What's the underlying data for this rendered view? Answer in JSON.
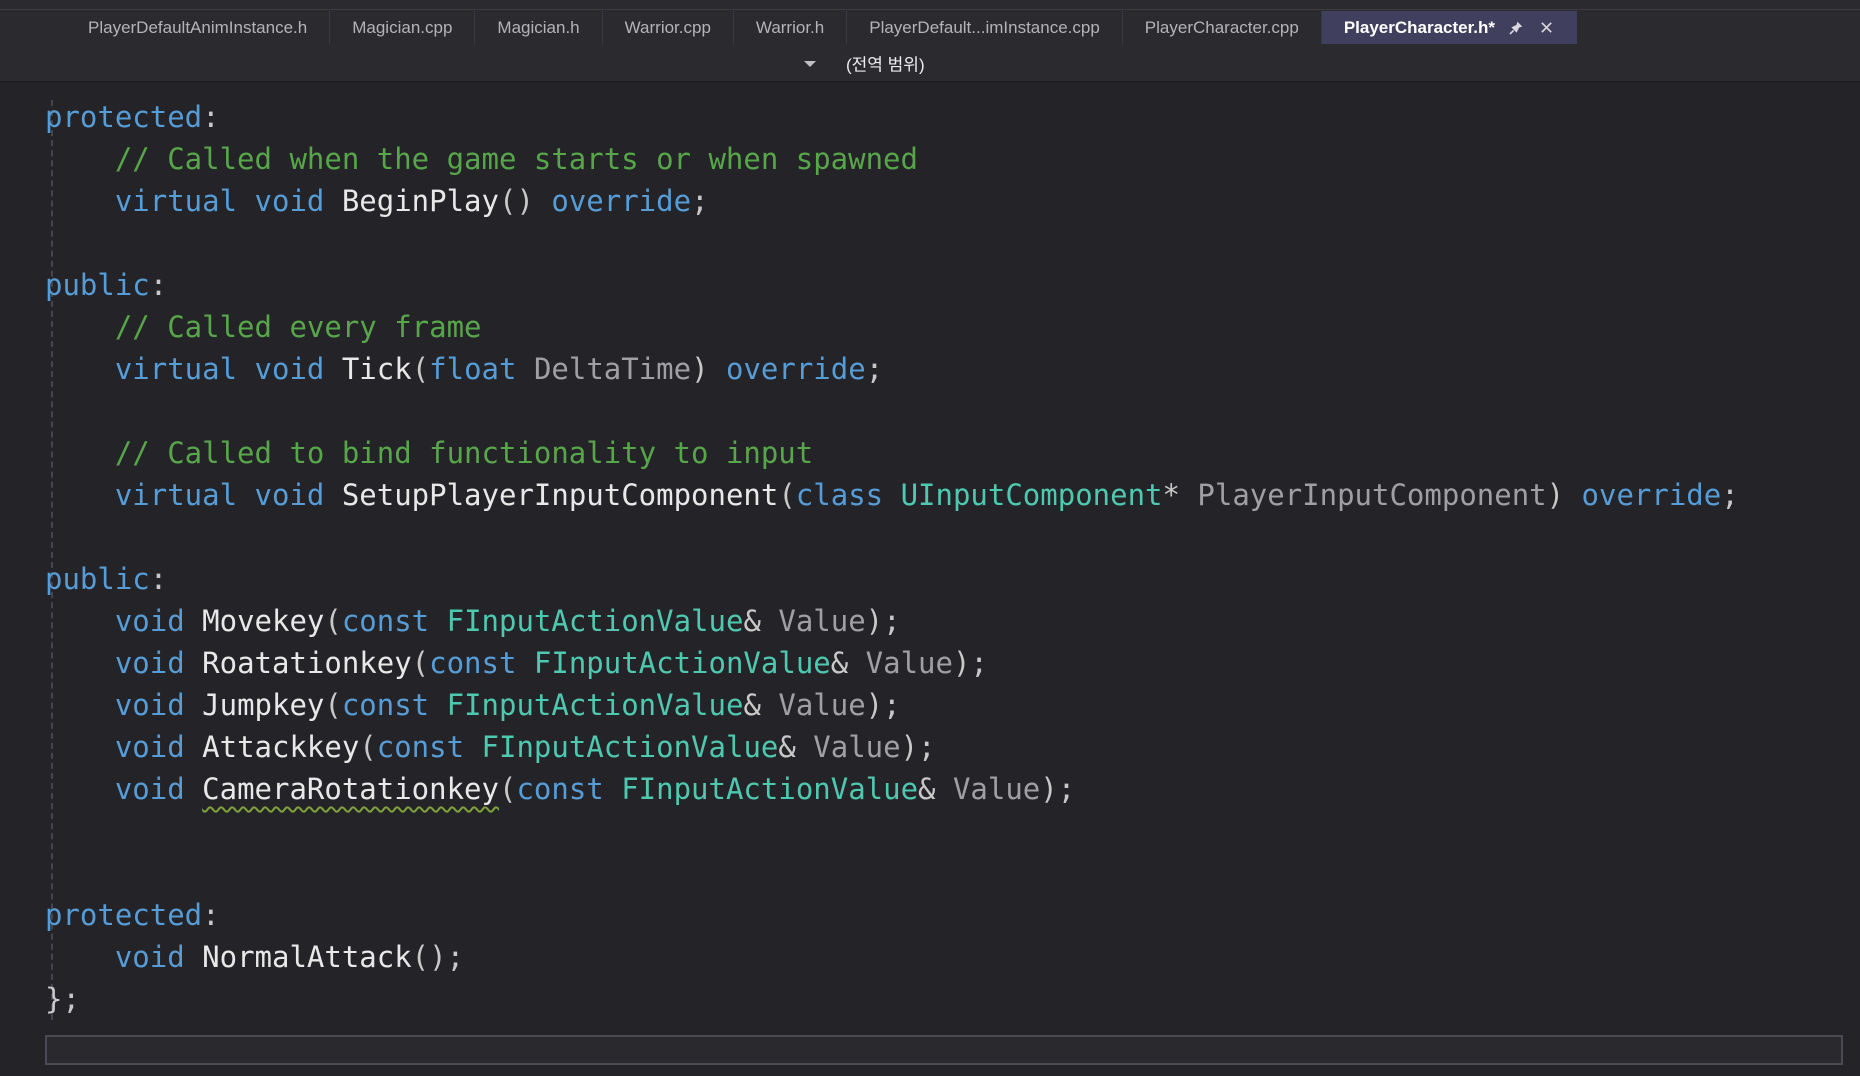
{
  "colors": {
    "editor_bg": "#242428",
    "tabbar_bg": "#2B2B2F",
    "active_tab_bg": "#40405E",
    "keyword": "#569CD6",
    "comment": "#57A64A",
    "type": "#4EC9B0",
    "parameter": "#A0A0A4",
    "function_name": "#E8E8E8",
    "punctuation": "#C8C8C8",
    "squiggle": "#7FA23C"
  },
  "tabbar": {
    "tabs": [
      {
        "label": "PlayerDefaultAnimInstance.h",
        "active": false
      },
      {
        "label": "Magician.cpp",
        "active": false
      },
      {
        "label": "Magician.h",
        "active": false
      },
      {
        "label": "Warrior.cpp",
        "active": false
      },
      {
        "label": "Warrior.h",
        "active": false
      },
      {
        "label": "PlayerDefault...imInstance.cpp",
        "active": false
      },
      {
        "label": "PlayerCharacter.cpp",
        "active": false
      },
      {
        "label": "PlayerCharacter.h*",
        "active": true
      }
    ],
    "active_tab_icons": {
      "pin": "pushpin-icon",
      "close": "close-icon"
    }
  },
  "navbar": {
    "dropdown_icon": "caret-down",
    "scope_label": "(전역 범위)"
  },
  "code": {
    "lines": [
      {
        "tokens": [
          [
            "kw",
            "protected"
          ],
          [
            "pl",
            ":"
          ]
        ]
      },
      {
        "tokens": [
          [
            "pl",
            "    "
          ],
          [
            "cm",
            "// Called when the game starts or when spawned"
          ]
        ]
      },
      {
        "tokens": [
          [
            "pl",
            "    "
          ],
          [
            "kw",
            "virtual"
          ],
          [
            "pl",
            " "
          ],
          [
            "kw",
            "void"
          ],
          [
            "pl",
            " "
          ],
          [
            "fn",
            "BeginPlay"
          ],
          [
            "pl",
            "() "
          ],
          [
            "kw",
            "override"
          ],
          [
            "pl",
            ";"
          ]
        ]
      },
      {
        "tokens": []
      },
      {
        "tokens": [
          [
            "kw",
            "public"
          ],
          [
            "pl",
            ":"
          ]
        ]
      },
      {
        "tokens": [
          [
            "pl",
            "    "
          ],
          [
            "cm",
            "// Called every frame"
          ]
        ]
      },
      {
        "tokens": [
          [
            "pl",
            "    "
          ],
          [
            "kw",
            "virtual"
          ],
          [
            "pl",
            " "
          ],
          [
            "kw",
            "void"
          ],
          [
            "pl",
            " "
          ],
          [
            "fn",
            "Tick"
          ],
          [
            "pl",
            "("
          ],
          [
            "kw",
            "float"
          ],
          [
            "pl",
            " "
          ],
          [
            "pr",
            "DeltaTime"
          ],
          [
            "pl",
            ") "
          ],
          [
            "kw",
            "override"
          ],
          [
            "pl",
            ";"
          ]
        ]
      },
      {
        "tokens": []
      },
      {
        "tokens": [
          [
            "pl",
            "    "
          ],
          [
            "cm",
            "// Called to bind functionality to input"
          ]
        ]
      },
      {
        "tokens": [
          [
            "pl",
            "    "
          ],
          [
            "kw",
            "virtual"
          ],
          [
            "pl",
            " "
          ],
          [
            "kw",
            "void"
          ],
          [
            "pl",
            " "
          ],
          [
            "fn",
            "SetupPlayerInputComponent"
          ],
          [
            "pl",
            "("
          ],
          [
            "kw",
            "class"
          ],
          [
            "pl",
            " "
          ],
          [
            "ty",
            "UInputComponent"
          ],
          [
            "pl",
            "* "
          ],
          [
            "pr",
            "PlayerInputComponent"
          ],
          [
            "pl",
            ") "
          ],
          [
            "kw",
            "override"
          ],
          [
            "pl",
            ";"
          ]
        ]
      },
      {
        "tokens": []
      },
      {
        "tokens": [
          [
            "kw",
            "public"
          ],
          [
            "pl",
            ":"
          ]
        ]
      },
      {
        "tokens": [
          [
            "pl",
            "    "
          ],
          [
            "kw",
            "void"
          ],
          [
            "pl",
            " "
          ],
          [
            "fn",
            "Movekey"
          ],
          [
            "pl",
            "("
          ],
          [
            "kw",
            "const"
          ],
          [
            "pl",
            " "
          ],
          [
            "ty",
            "FInputActionValue"
          ],
          [
            "pl",
            "& "
          ],
          [
            "pr",
            "Value"
          ],
          [
            "pl",
            ");"
          ]
        ]
      },
      {
        "tokens": [
          [
            "pl",
            "    "
          ],
          [
            "kw",
            "void"
          ],
          [
            "pl",
            " "
          ],
          [
            "fn",
            "Roatationkey"
          ],
          [
            "pl",
            "("
          ],
          [
            "kw",
            "const"
          ],
          [
            "pl",
            " "
          ],
          [
            "ty",
            "FInputActionValue"
          ],
          [
            "pl",
            "& "
          ],
          [
            "pr",
            "Value"
          ],
          [
            "pl",
            ");"
          ]
        ]
      },
      {
        "tokens": [
          [
            "pl",
            "    "
          ],
          [
            "kw",
            "void"
          ],
          [
            "pl",
            " "
          ],
          [
            "fn",
            "Jumpkey"
          ],
          [
            "pl",
            "("
          ],
          [
            "kw",
            "const"
          ],
          [
            "pl",
            " "
          ],
          [
            "ty",
            "FInputActionValue"
          ],
          [
            "pl",
            "& "
          ],
          [
            "pr",
            "Value"
          ],
          [
            "pl",
            ");"
          ]
        ]
      },
      {
        "tokens": [
          [
            "pl",
            "    "
          ],
          [
            "kw",
            "void"
          ],
          [
            "pl",
            " "
          ],
          [
            "fn",
            "Attackkey"
          ],
          [
            "pl",
            "("
          ],
          [
            "kw",
            "const"
          ],
          [
            "pl",
            " "
          ],
          [
            "ty",
            "FInputActionValue"
          ],
          [
            "pl",
            "& "
          ],
          [
            "pr",
            "Value"
          ],
          [
            "pl",
            ");"
          ]
        ]
      },
      {
        "tokens": [
          [
            "pl",
            "    "
          ],
          [
            "kw",
            "void"
          ],
          [
            "pl",
            " "
          ],
          [
            "fn",
            "CameraRotationkey",
            "squiggle"
          ],
          [
            "pl",
            "("
          ],
          [
            "kw",
            "const"
          ],
          [
            "pl",
            " "
          ],
          [
            "ty",
            "FInputActionValue"
          ],
          [
            "pl",
            "& "
          ],
          [
            "pr",
            "Value"
          ],
          [
            "pl",
            ");"
          ]
        ]
      },
      {
        "tokens": []
      },
      {
        "tokens": []
      },
      {
        "tokens": [
          [
            "kw",
            "protected"
          ],
          [
            "pl",
            ":"
          ]
        ]
      },
      {
        "tokens": [
          [
            "pl",
            "    "
          ],
          [
            "kw",
            "void"
          ],
          [
            "pl",
            " "
          ],
          [
            "fn",
            "NormalAttack"
          ],
          [
            "pl",
            "();"
          ]
        ]
      },
      {
        "tokens": [
          [
            "pl",
            "};"
          ]
        ]
      }
    ]
  }
}
